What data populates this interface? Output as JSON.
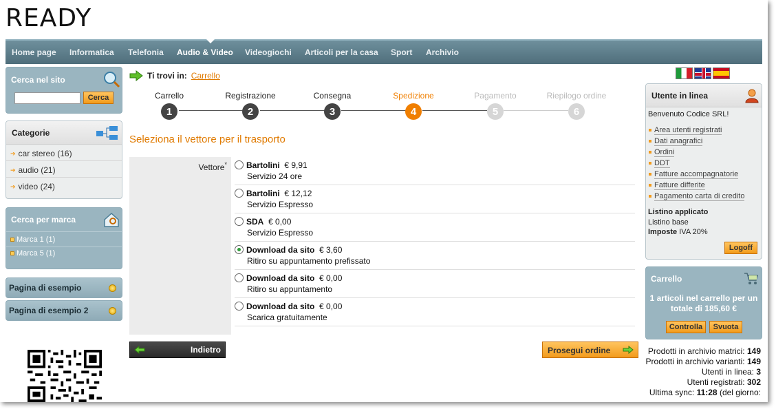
{
  "logo": "READY",
  "nav": {
    "items": [
      "Home page",
      "Informatica",
      "Telefonia",
      "Audio & Video",
      "Videogiochi",
      "Articoli per la casa",
      "Sport",
      "Archivio"
    ],
    "active": "Audio & Video"
  },
  "search": {
    "title": "Cerca nel sito",
    "placeholder": "",
    "button": "Cerca"
  },
  "categories": {
    "title": "Categorie",
    "items": [
      "car stereo (16)",
      "audio (21)",
      "video (24)"
    ]
  },
  "brands": {
    "title": "Cerca per marca",
    "items": [
      "Marca 1 (1)",
      "Marca 5 (1)"
    ]
  },
  "pages": [
    "Pagina di esempio",
    "Pagina di esempio 2"
  ],
  "breadcrumb": {
    "prefix": "Ti trovi in:",
    "link": "Carrello"
  },
  "steps": [
    {
      "label": "Carrello",
      "num": "1",
      "state": "done"
    },
    {
      "label": "Registrazione",
      "num": "2",
      "state": "done"
    },
    {
      "label": "Consegna",
      "num": "3",
      "state": "done"
    },
    {
      "label": "Spedizione",
      "num": "4",
      "state": "current"
    },
    {
      "label": "Pagamento",
      "num": "5",
      "state": "todo"
    },
    {
      "label": "Riepilogo ordine",
      "num": "6",
      "state": "todo"
    }
  ],
  "section_title": "Seleziona il vettore per il trasporto",
  "form": {
    "label": "Vettore",
    "required_mark": "*",
    "options": [
      {
        "name": "Bartolini",
        "price": "€ 9,91",
        "desc": "Servizio 24 ore",
        "checked": false
      },
      {
        "name": "Bartolini",
        "price": "€ 12,12",
        "desc": "Servizio Espresso",
        "checked": false
      },
      {
        "name": "SDA",
        "price": "€ 0,00",
        "desc": "Servizio Espresso",
        "checked": false
      },
      {
        "name": "Download da sito",
        "price": "€ 3,60",
        "desc": "Ritiro su appuntamento prefissato",
        "checked": true
      },
      {
        "name": "Download da sito",
        "price": "€ 0,00",
        "desc": "Ritiro su appuntamento",
        "checked": false
      },
      {
        "name": "Download da sito",
        "price": "€ 0,00",
        "desc": "Scarica gratuitamente",
        "checked": false
      }
    ]
  },
  "buttons": {
    "back": "Indietro",
    "next": "Prosegui ordine"
  },
  "user": {
    "title": "Utente in linea",
    "welcome": "Benvenuto Codice SRL!",
    "links": [
      "Area utenti registrati",
      "Dati anagrafici",
      "Ordini",
      "DDT",
      "Fatture accompagnatorie",
      "Fatture differite",
      "Pagamento carta di credito"
    ],
    "listino_label": "Listino applicato",
    "listino_value": "Listino base",
    "imposte_label": "Imposte",
    "imposte_value": "IVA 20%",
    "logoff": "Logoff"
  },
  "cart": {
    "title": "Carrello",
    "summary": "1 articoli nel carrello per un totale di 185,60 €",
    "check": "Controlla",
    "empty": "Svuota"
  },
  "stats": {
    "matrici_label": "Prodotti in archivio matrici:",
    "matrici": "149",
    "varianti_label": "Prodotti in archivio varianti:",
    "varianti": "149",
    "online_label": "Utenti in linea:",
    "online": "3",
    "registered_label": "Utenti registrati:",
    "registered": "302",
    "sync_label": "Ultima sync:",
    "sync_time": "11:28",
    "sync_suffix": "(del giorno:"
  },
  "colors": {
    "accent": "#f07f00",
    "nav": "#5a7a87",
    "box": "#9ab5c0"
  }
}
